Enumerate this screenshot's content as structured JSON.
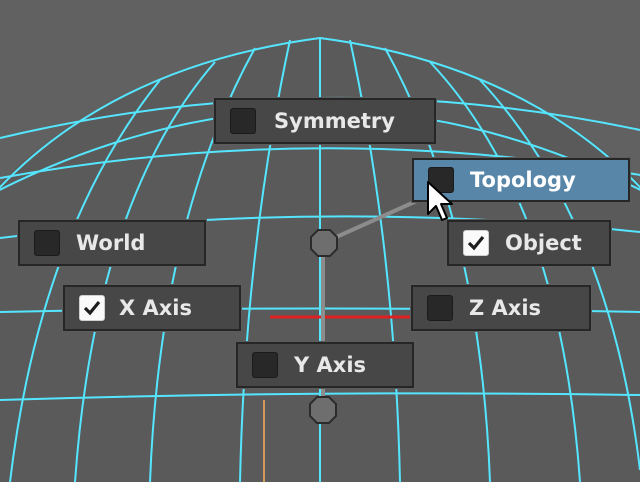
{
  "marking_menu": {
    "items": [
      {
        "id": "symmetry",
        "label": "Symmetry",
        "checked": false,
        "highlighted": false
      },
      {
        "id": "topology",
        "label": "Topology",
        "checked": false,
        "highlighted": true
      },
      {
        "id": "world",
        "label": "World",
        "checked": false,
        "highlighted": false
      },
      {
        "id": "object",
        "label": "Object",
        "checked": true,
        "highlighted": false
      },
      {
        "id": "x-axis",
        "label": "X Axis",
        "checked": true,
        "highlighted": false
      },
      {
        "id": "z-axis",
        "label": "Z Axis",
        "checked": false,
        "highlighted": false
      },
      {
        "id": "y-axis",
        "label": "Y Axis",
        "checked": false,
        "highlighted": false
      }
    ]
  },
  "colors": {
    "viewport_bg": "#616161",
    "wireframe": "#55e6ff",
    "menu_bg": "#474747",
    "menu_highlight": "#5786a8",
    "axis_red": "#e02020",
    "axis_orange": "#d49a5a",
    "gesture_line": "#8c8c8c"
  },
  "icons": {
    "checkbox": "checkbox-icon",
    "checkmark": "checkmark-icon",
    "pointer": "arrow-cursor-icon",
    "center_node": "menu-center-icon"
  }
}
